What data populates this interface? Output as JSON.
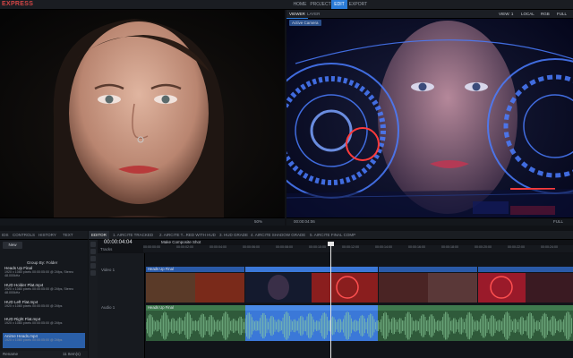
{
  "app": {
    "logo": "EXPRESS"
  },
  "nav": {
    "tabs": [
      {
        "label": "HOME",
        "active": false
      },
      {
        "label": "PROJECT",
        "active": false
      },
      {
        "label": "EDIT",
        "active": true
      },
      {
        "label": "EXPORT",
        "active": false
      }
    ]
  },
  "left_viewer": {
    "footer_zoom": "50%"
  },
  "right_viewer": {
    "tabs": [
      {
        "label": "VIEWER",
        "active": true
      },
      {
        "label": "LAYER",
        "active": false
      }
    ],
    "view_ctl": "VIEW: 1",
    "space_ctl": "LOCAL",
    "channel_ctl": "RGB",
    "zoom_ctl": "FULL",
    "camera_badge": "Active Camera",
    "footer_timecode": "00:00:04:06",
    "footer_zoom": "FULL"
  },
  "panel": {
    "tabs": [
      "IDS",
      "CONTROLS",
      "HISTORY",
      "TEXT"
    ],
    "new_label": "New",
    "group_by": "Group By: Folder",
    "items": [
      {
        "name": "Heads Up Final",
        "meta": "1920 x 1080 pixels\n00:00:05:00 @ 24fps, Stereo 48.000kHz",
        "active": false
      },
      {
        "name": "HUD Holder Plat.mp4",
        "meta": "1920 x 1080 pixels\n00:00:05:00 @ 24fps, Stereo 48.000kHz",
        "active": false
      },
      {
        "name": "HUD Left Flat.mp4",
        "meta": "1920 x 1080 pixels\n00:00:05:00 @ 24fps",
        "active": false
      },
      {
        "name": "HUD Right Flat.mp4",
        "meta": "1920 x 1080 pixels\n00:00:05:00 @ 24fps",
        "active": false
      },
      {
        "name": "Anime Heads.mp4",
        "meta": "1920 x 1080 pixels\n00:00:05:00 @ 24fps",
        "active": true
      }
    ],
    "footer_left": "Rename",
    "footer_right": "11 Item(s)"
  },
  "timeline": {
    "tabs": [
      {
        "label": "EDITOR",
        "active": true
      },
      {
        "label": "1. AIRCITE TRACKED",
        "active": false
      },
      {
        "label": "2. AIRCITE T...RED WITH HUD",
        "active": false
      },
      {
        "label": "3. HUD GRADE",
        "active": false
      },
      {
        "label": "4. AIRCITE SHADOW GRADE",
        "active": false
      },
      {
        "label": "5. AIRCITE FINAL COMP",
        "active": false
      }
    ],
    "timecode": "00:00:04:04",
    "tracks_label": "Tracks",
    "comp_shot": "Make Composite Shot",
    "ruler_ticks": [
      "00:00:00:00",
      "00:00:02:00",
      "00:00:04:00",
      "00:00:06:00",
      "00:00:08:00",
      "00:00:10:00",
      "00:00:12:00",
      "00:00:14:00",
      "00:00:16:00",
      "00:00:18:00",
      "00:00:20:00",
      "00:00:22:00",
      "00:00:24:00"
    ],
    "video_track_name": "Video 1",
    "audio_track_name": "Audio 1",
    "clip_label": "Heads Up Final"
  },
  "colors": {
    "accent": "#2a7bd6",
    "logo": "#d24545",
    "audio": "#2f5a3a"
  }
}
